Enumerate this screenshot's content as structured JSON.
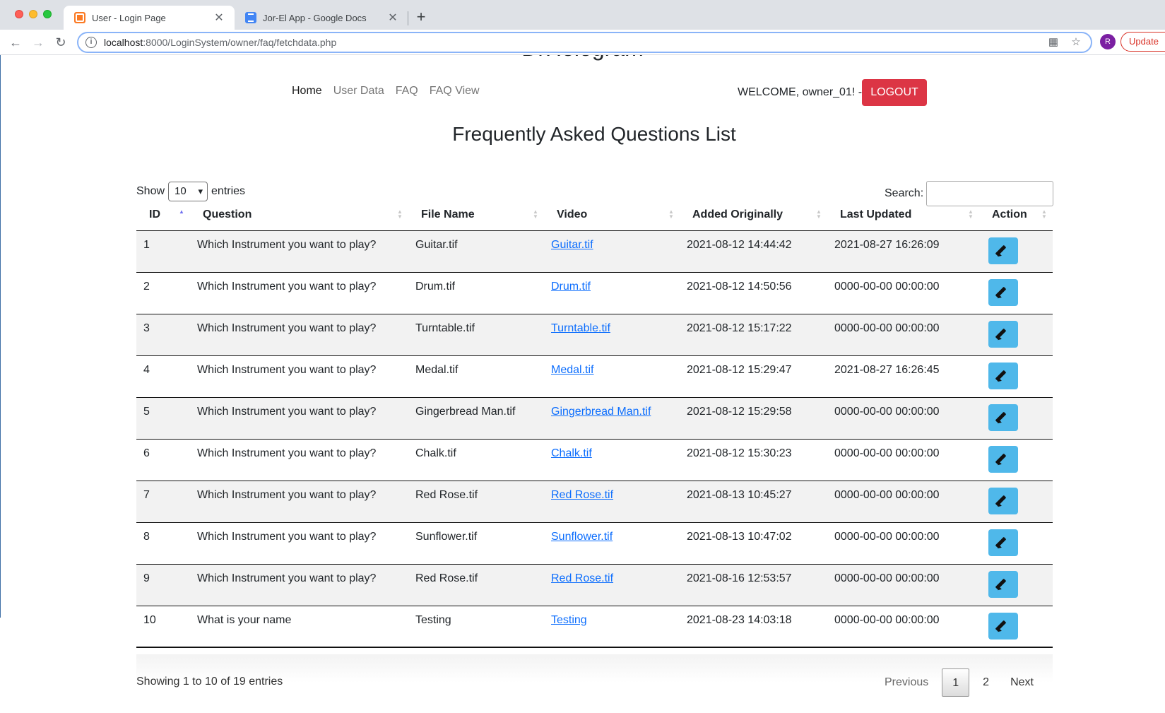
{
  "browser": {
    "tabs": [
      {
        "title": "User - Login Page",
        "favicon": "xampp-icon"
      },
      {
        "title": "Jor-El App - Google Docs",
        "favicon": "google-docs-icon"
      }
    ],
    "url_host": "localhost",
    "url_rest": ":8000/LoginSystem/owner/faq/fetchdata.php",
    "profile_initial": "R",
    "update_label": "Update"
  },
  "page": {
    "brand": "DrHologram",
    "nav": [
      "Home",
      "User Data",
      "FAQ",
      "FAQ View"
    ],
    "welcome": "WELCOME, owner_01! -",
    "logout": "LOGOUT",
    "title": "Frequently Asked Questions List"
  },
  "datatable": {
    "length_prefix": "Show",
    "length_value": "10",
    "length_suffix": "entries",
    "search_label": "Search:",
    "search_value": "",
    "columns": [
      "ID",
      "Question",
      "File Name",
      "Video",
      "Added Originally",
      "Last Updated",
      "Action"
    ],
    "sorted_column": "ID",
    "rows": [
      {
        "id": "1",
        "question": "Which Instrument you want to play?",
        "file": "Guitar.tif",
        "video": "Guitar.tif",
        "added": "2021-08-12 14:44:42",
        "updated": "2021-08-27 16:26:09"
      },
      {
        "id": "2",
        "question": "Which Instrument you want to play?",
        "file": "Drum.tif",
        "video": "Drum.tif",
        "added": "2021-08-12 14:50:56",
        "updated": "0000-00-00 00:00:00"
      },
      {
        "id": "3",
        "question": "Which Instrument you want to play?",
        "file": "Turntable.tif",
        "video": "Turntable.tif",
        "added": "2021-08-12 15:17:22",
        "updated": "0000-00-00 00:00:00"
      },
      {
        "id": "4",
        "question": "Which Instrument you want to play?",
        "file": "Medal.tif",
        "video": "Medal.tif",
        "added": "2021-08-12 15:29:47",
        "updated": "2021-08-27 16:26:45"
      },
      {
        "id": "5",
        "question": "Which Instrument you want to play?",
        "file": "Gingerbread Man.tif",
        "video": "Gingerbread Man.tif",
        "added": "2021-08-12 15:29:58",
        "updated": "0000-00-00 00:00:00"
      },
      {
        "id": "6",
        "question": "Which Instrument you want to play?",
        "file": "Chalk.tif",
        "video": "Chalk.tif",
        "added": "2021-08-12 15:30:23",
        "updated": "0000-00-00 00:00:00"
      },
      {
        "id": "7",
        "question": "Which Instrument you want to play?",
        "file": "Red Rose.tif",
        "video": "Red Rose.tif",
        "added": "2021-08-13 10:45:27",
        "updated": "0000-00-00 00:00:00"
      },
      {
        "id": "8",
        "question": "Which Instrument you want to play?",
        "file": "Sunflower.tif",
        "video": "Sunflower.tif",
        "added": "2021-08-13 10:47:02",
        "updated": "0000-00-00 00:00:00"
      },
      {
        "id": "9",
        "question": "Which Instrument you want to play?",
        "file": "Red Rose.tif",
        "video": "Red Rose.tif",
        "added": "2021-08-16 12:53:57",
        "updated": "0000-00-00 00:00:00"
      },
      {
        "id": "10",
        "question": "What is your name",
        "file": "Testing",
        "video": "Testing",
        "added": "2021-08-23 14:03:18",
        "updated": "0000-00-00 00:00:00"
      }
    ],
    "info": "Showing 1 to 10 of 19 entries",
    "pagination": {
      "previous": "Previous",
      "pages": [
        "1",
        "2"
      ],
      "current": "1",
      "next": "Next"
    }
  },
  "colors": {
    "logout": "#dc3545",
    "edit_button": "#4fb8ea",
    "link": "#0d6efd",
    "sort_active": "#6f6ff0"
  }
}
